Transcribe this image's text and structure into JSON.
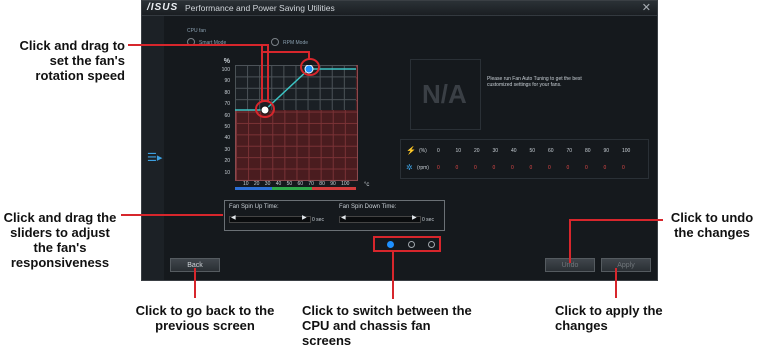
{
  "app": {
    "logo": "/ISUS",
    "title": "Performance and Power Saving Utilities",
    "close_glyph": "✕",
    "fan_label": "CPU fan",
    "mode_a": "Smart Mode",
    "mode_b": "RPM Mode",
    "y_unit": "%",
    "y_ticks": [
      "100",
      "90",
      "80",
      "70",
      "60",
      "50",
      "40",
      "30",
      "20",
      "10"
    ],
    "x_ticks": [
      "10",
      "20",
      "30",
      "40",
      "50",
      "60",
      "70",
      "80",
      "90",
      "100"
    ],
    "x_unit": "°c",
    "na_text": "N/A",
    "tune_text": "Please run Fan Auto Tuning to get the best customized settings for your fans.",
    "table": {
      "percent_label": "(%)",
      "rpm_label": "(rpm)",
      "percent_values": [
        "0",
        "10",
        "20",
        "30",
        "40",
        "50",
        "60",
        "70",
        "80",
        "90",
        "100"
      ],
      "rpm_values": [
        "0",
        "0",
        "0",
        "0",
        "0",
        "0",
        "0",
        "0",
        "0",
        "0",
        "0"
      ]
    },
    "spin_up_label": "Fan Spin Up Time:",
    "spin_down_label": "Fan Spin Down Time:",
    "spin_up_value": "0 sec",
    "spin_down_value": "0 sec",
    "back_button": "Back",
    "undo_button": "Undo",
    "apply_button": "Apply"
  },
  "callouts": {
    "drag_fan": "Click and drag to set the fan's rotation speed",
    "drag_sliders": "Click and drag the sliders to adjust the fan's responsiveness",
    "undo": "Click to undo the changes",
    "back": "Click to go back to the previous screen",
    "switch": "Click to switch between the CPU and chassis fan screens",
    "apply": "Click to apply the changes"
  },
  "colors": {
    "callout_line": "#d7262c",
    "accent_blue": "#1e90ff",
    "curve": "#3cc4c4"
  },
  "curve_points_pct": [
    {
      "temp_c": 10,
      "speed_pct": 60
    },
    {
      "temp_c": 30,
      "speed_pct": 60
    },
    {
      "temp_c": 70,
      "speed_pct": 100
    },
    {
      "temp_c": 100,
      "speed_pct": 100
    }
  ]
}
